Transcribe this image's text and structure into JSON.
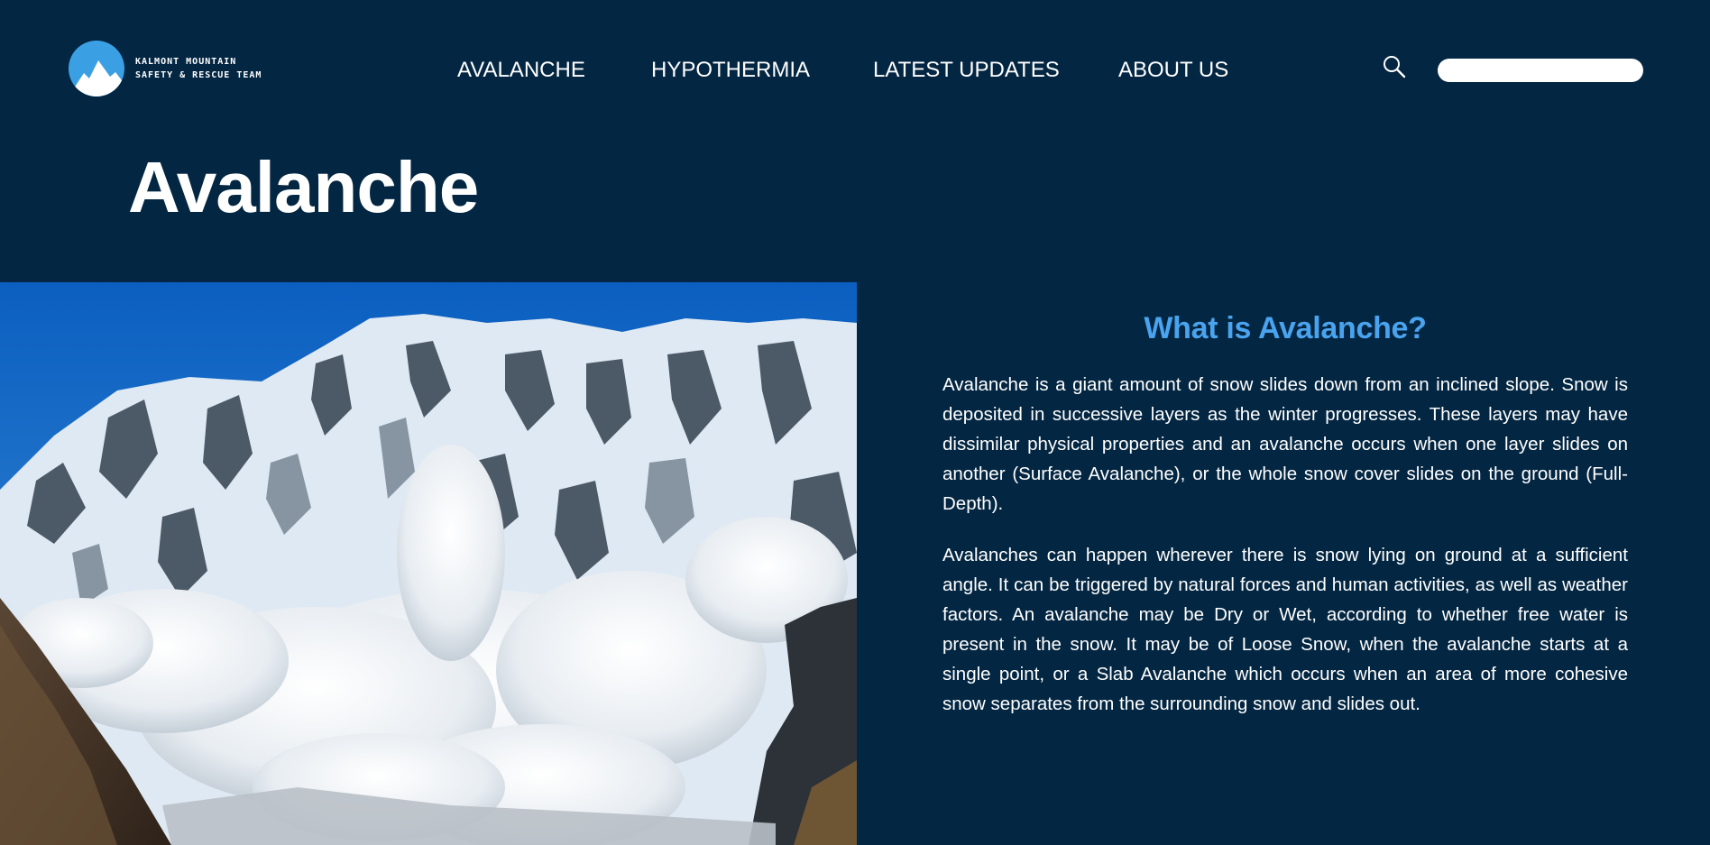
{
  "brand": {
    "line1": "KALMONT MOUNTAIN",
    "line2": "SAFETY & RESCUE TEAM",
    "logo_icon": "mountain-logo-icon",
    "accent_color": "#3aa0e3"
  },
  "nav": {
    "items": [
      {
        "label": "AVALANCHE"
      },
      {
        "label": "HYPOTHERMIA"
      },
      {
        "label": "LATEST UPDATES"
      },
      {
        "label": "ABOUT US"
      }
    ]
  },
  "search": {
    "icon": "search-icon",
    "value": ""
  },
  "page": {
    "title": "Avalanche",
    "background": "#032642"
  },
  "article": {
    "heading": "What is Avalanche?",
    "heading_color": "#4aa3ee",
    "paragraphs": [
      "Avalanche is a giant amount of snow slides down from an inclined slope. Snow is deposited in successive layers as the winter progresses. These layers may have dissimilar physical properties and an avalanche occurs when one layer slides on another (Surface Avalanche), or the whole snow cover slides on the ground (Full-Depth).",
      "Avalanches can happen wherever there is snow lying on ground at a sufficient angle. It can be triggered by natural forces and human activities, as well as weather factors. An avalanche may be Dry or Wet, according to whether free water is present in the snow. It may be of Loose Snow, when the avalanche starts at a single point, or a Slab Avalanche which occurs when an area of more cohesive snow separates from the surrounding snow and slides out."
    ]
  }
}
